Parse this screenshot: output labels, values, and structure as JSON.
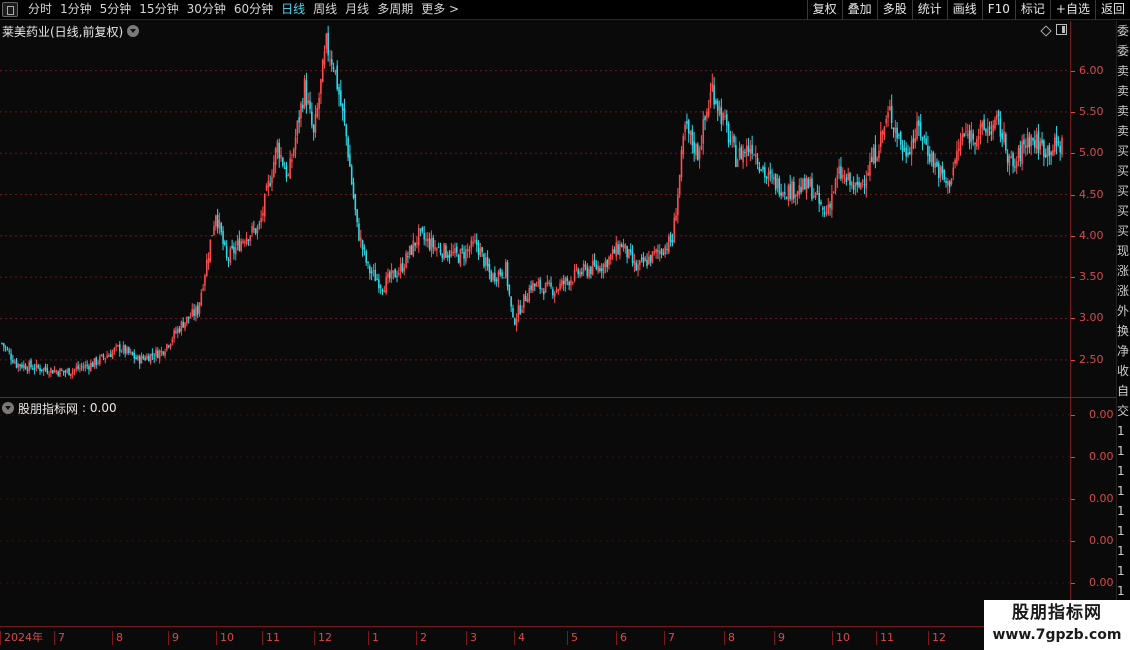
{
  "toolbar": {
    "periods": [
      "分时",
      "1分钟",
      "5分钟",
      "15分钟",
      "30分钟",
      "60分钟",
      "日线",
      "周线",
      "月线",
      "多周期",
      "更多 >"
    ],
    "active_period": "日线",
    "tools": [
      "复权",
      "叠加",
      "多股",
      "统计",
      "画线",
      "F10",
      "标记",
      "+自选",
      "返回"
    ]
  },
  "main_panel": {
    "title": "莱美药业(日线,前复权)",
    "price_ticks": [
      "6.00",
      "5.50",
      "5.00",
      "4.50",
      "4.00",
      "3.50",
      "3.00",
      "2.50"
    ]
  },
  "indicator_panel": {
    "title": "股朋指标网",
    "value_text": ": 0.00",
    "ticks": [
      "0.00",
      "0.00",
      "0.00",
      "0.00",
      "0.00"
    ]
  },
  "time_axis": {
    "labels": [
      "2024年",
      "7",
      "8",
      "9",
      "10",
      "11",
      "12",
      "1",
      "2",
      "3",
      "4",
      "5",
      "6",
      "7",
      "8",
      "9",
      "10",
      "11",
      "12"
    ]
  },
  "right_strip": [
    "委",
    "委",
    "卖",
    "卖",
    "卖",
    "卖",
    "买",
    "买",
    "买",
    "买",
    "买",
    "现",
    "涨",
    "涨",
    "外",
    "换",
    "净",
    "收",
    "自",
    "交",
    "1",
    "1",
    "1",
    "1",
    "1",
    "1",
    "1",
    "1",
    "1"
  ],
  "watermark": {
    "line1": "股朋指标网",
    "line2": "www.7gpzb.com"
  },
  "colors": {
    "up": "#ff4d4d",
    "down": "#2fd8e8",
    "axis": "#d84a4a",
    "grid": "#7a1a1a",
    "active_tab": "#4fd8f0"
  },
  "chart_data": {
    "type": "candlestick",
    "title": "莱美药业(日线,前复权)",
    "y_ticks": [
      2.5,
      3.0,
      3.5,
      4.0,
      4.5,
      5.0,
      5.5,
      6.0
    ],
    "ylim": [
      2.05,
      6.6
    ],
    "x_labels": [
      "2024年",
      "7",
      "8",
      "9",
      "10",
      "11",
      "12",
      "1",
      "2",
      "3",
      "4",
      "5",
      "6",
      "7",
      "8",
      "9",
      "10",
      "11",
      "12"
    ],
    "close_path": [
      {
        "i": 0,
        "c": 2.7
      },
      {
        "i": 8,
        "c": 2.45
      },
      {
        "i": 20,
        "c": 2.4
      },
      {
        "i": 35,
        "c": 2.35
      },
      {
        "i": 50,
        "c": 2.45
      },
      {
        "i": 65,
        "c": 2.65
      },
      {
        "i": 75,
        "c": 2.5
      },
      {
        "i": 88,
        "c": 2.6
      },
      {
        "i": 100,
        "c": 2.95
      },
      {
        "i": 108,
        "c": 3.1
      },
      {
        "i": 114,
        "c": 3.8
      },
      {
        "i": 118,
        "c": 4.3
      },
      {
        "i": 124,
        "c": 3.7
      },
      {
        "i": 134,
        "c": 4.0
      },
      {
        "i": 142,
        "c": 4.1
      },
      {
        "i": 152,
        "c": 5.1
      },
      {
        "i": 158,
        "c": 4.7
      },
      {
        "i": 167,
        "c": 5.8
      },
      {
        "i": 172,
        "c": 5.2
      },
      {
        "i": 179,
        "c": 6.3
      },
      {
        "i": 183,
        "c": 6.1
      },
      {
        "i": 190,
        "c": 5.2
      },
      {
        "i": 196,
        "c": 4.1
      },
      {
        "i": 202,
        "c": 3.6
      },
      {
        "i": 210,
        "c": 3.4
      },
      {
        "i": 220,
        "c": 3.6
      },
      {
        "i": 230,
        "c": 4.0
      },
      {
        "i": 240,
        "c": 3.85
      },
      {
        "i": 252,
        "c": 3.75
      },
      {
        "i": 262,
        "c": 3.9
      },
      {
        "i": 270,
        "c": 3.5
      },
      {
        "i": 278,
        "c": 3.6
      },
      {
        "i": 282,
        "c": 2.95
      },
      {
        "i": 292,
        "c": 3.4
      },
      {
        "i": 305,
        "c": 3.35
      },
      {
        "i": 318,
        "c": 3.55
      },
      {
        "i": 332,
        "c": 3.65
      },
      {
        "i": 342,
        "c": 3.9
      },
      {
        "i": 350,
        "c": 3.6
      },
      {
        "i": 362,
        "c": 3.8
      },
      {
        "i": 370,
        "c": 3.95
      },
      {
        "i": 377,
        "c": 5.3
      },
      {
        "i": 384,
        "c": 5.0
      },
      {
        "i": 392,
        "c": 5.8
      },
      {
        "i": 398,
        "c": 5.4
      },
      {
        "i": 405,
        "c": 4.95
      },
      {
        "i": 414,
        "c": 5.1
      },
      {
        "i": 422,
        "c": 4.7
      },
      {
        "i": 434,
        "c": 4.55
      },
      {
        "i": 446,
        "c": 4.6
      },
      {
        "i": 454,
        "c": 4.25
      },
      {
        "i": 462,
        "c": 4.75
      },
      {
        "i": 472,
        "c": 4.55
      },
      {
        "i": 482,
        "c": 5.0
      },
      {
        "i": 490,
        "c": 5.5
      },
      {
        "i": 498,
        "c": 5.0
      },
      {
        "i": 506,
        "c": 5.3
      },
      {
        "i": 514,
        "c": 4.9
      },
      {
        "i": 522,
        "c": 4.6
      },
      {
        "i": 530,
        "c": 5.2
      },
      {
        "i": 540,
        "c": 5.25
      },
      {
        "i": 550,
        "c": 5.35
      },
      {
        "i": 558,
        "c": 4.8
      },
      {
        "i": 566,
        "c": 5.2
      },
      {
        "i": 576,
        "c": 5.05
      },
      {
        "i": 585,
        "c": 5.1
      }
    ],
    "bar_count": 586
  }
}
